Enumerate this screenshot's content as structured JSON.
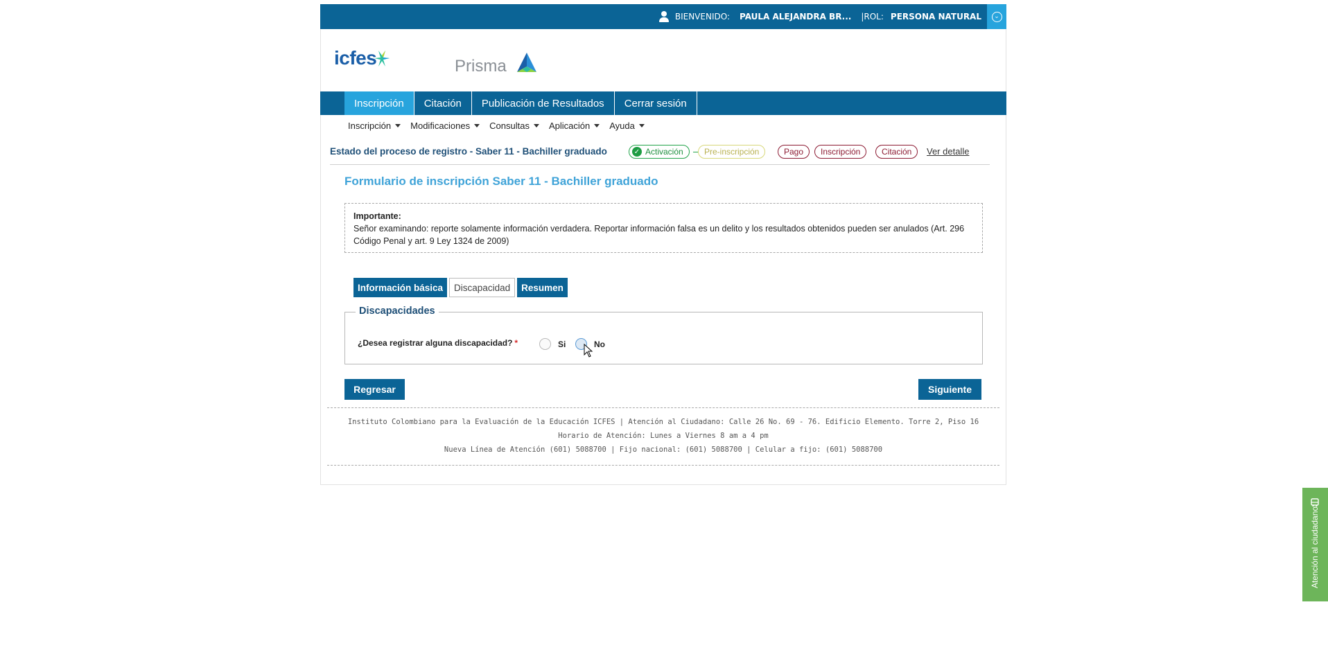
{
  "topbar": {
    "welcome_label": "BIENVENIDO:",
    "user_name": "PAULA ALEJANDRA BR...",
    "role_label": "|ROL:",
    "role_value": "PERSONA NATURAL"
  },
  "logos": {
    "icfes": "icfes",
    "prisma": "Prisma"
  },
  "main_nav": {
    "items": [
      {
        "label": "Inscripción",
        "active": true
      },
      {
        "label": "Citación",
        "active": false
      },
      {
        "label": "Publicación de Resultados",
        "active": false
      },
      {
        "label": "Cerrar sesión",
        "active": false
      }
    ]
  },
  "sub_nav": {
    "items": [
      "Inscripción",
      "Modificaciones",
      "Consultas",
      "Aplicación",
      "Ayuda"
    ]
  },
  "status": {
    "title": "Estado del proceso de registro - Saber 11 - Bachiller graduado",
    "steps": [
      {
        "label": "Activación",
        "state": "done"
      },
      {
        "label": "Pre-inscripción",
        "state": "current"
      },
      {
        "label": "Pago",
        "state": "pending"
      },
      {
        "label": "Inscripción",
        "state": "pending"
      },
      {
        "label": "Citación",
        "state": "pending"
      }
    ],
    "detail_link": "Ver detalle"
  },
  "form": {
    "title": "Formulario de inscripción Saber 11 - Bachiller graduado",
    "important_heading": "Importante:",
    "important_text": "Señor examinando: reporte solamente información verdadera. Reportar información falsa es un delito y los resultados obtenidos pueden ser anulados (Art. 296 Código Penal y art. 9 Ley 1324 de 2009)",
    "tabs": [
      {
        "label": "Información básica",
        "active": false
      },
      {
        "label": "Discapacidad",
        "active": true
      },
      {
        "label": "Resumen",
        "active": false
      }
    ],
    "section_legend": "Discapacidades",
    "question": "¿Desea registrar alguna discapacidad?",
    "required_mark": "*",
    "options": [
      "Si",
      "No"
    ],
    "back_button": "Regresar",
    "next_button": "Siguiente"
  },
  "footer": {
    "line1": "Instituto Colombiano para la Evaluación de la Educación ICFES  |   Atención al Ciudadano: Calle 26 No. 69 - 76. Edificio Elemento. Torre 2, Piso 16",
    "line2": "Horario de Atención: Lunes a Viernes 8 am a 4 pm",
    "line3": "Nueva Línea de Atención (601) 5088700   |   Fijo nacional: (601) 5088700   |   Celular a fijo: (601) 5088700"
  },
  "side_tab": {
    "label": "Atención al ciudadano"
  },
  "colors": {
    "primary": "#0b6496",
    "accent": "#27a4dd",
    "title_blue": "#3fa3d8",
    "done_green": "#1e9c43",
    "pending_red": "#8c1a32",
    "current_yellow": "#d8d87a",
    "side_green": "#6db55a"
  }
}
